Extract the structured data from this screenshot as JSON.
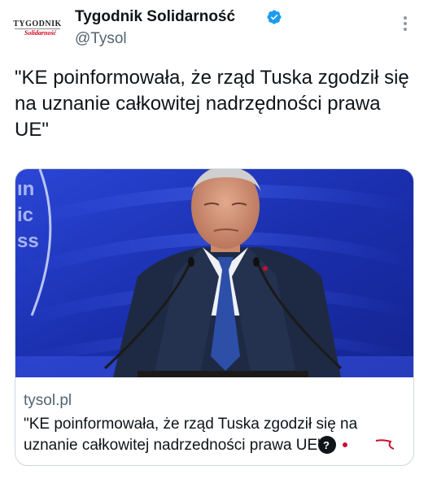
{
  "header": {
    "avatar_logo": "TYGODNIK Solidarność",
    "display_name": "Tygodnik Solidarność",
    "handle": "@Tysol"
  },
  "tweet": {
    "text": "\"KE poinformowała, że rząd Tuska zgodził się na uznanie całkowitej nadrzędności prawa UE\""
  },
  "card": {
    "domain": "tysol.pl",
    "title": "\"KE poinformowała, że rząd Tuska zgodził się na uznanie całkowitej nadrzedności prawa UE\"",
    "backdrop_letters": [
      "ın",
      "ic",
      "ss"
    ]
  },
  "icons": {
    "verified": "verified-badge-icon",
    "more": "more-options-icon"
  },
  "colors": {
    "verified_blue": "#1d9bf0",
    "secondary_text": "#536471",
    "card_border": "#cfd9de",
    "backdrop_blue": "#1f38c8"
  }
}
